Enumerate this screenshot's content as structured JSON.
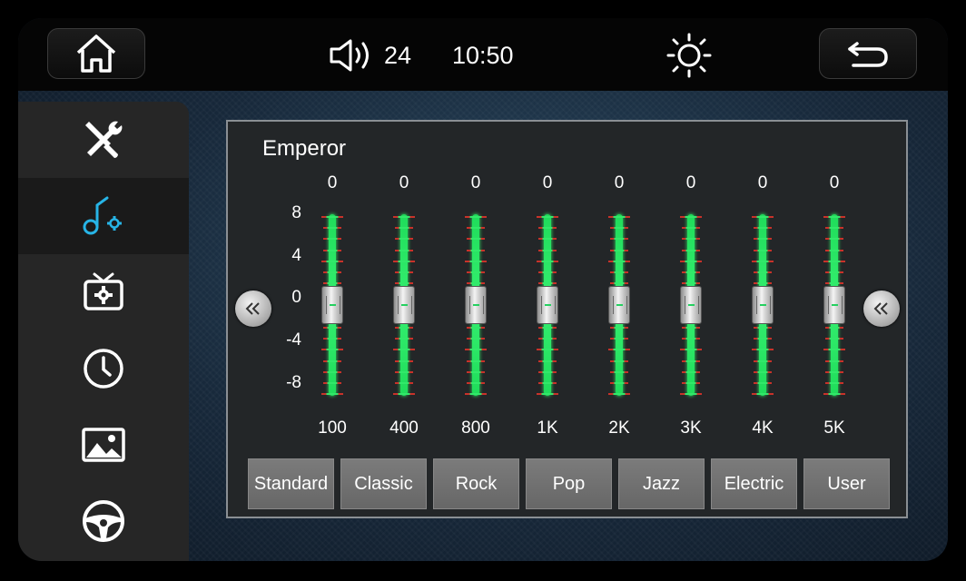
{
  "status": {
    "volume": "24",
    "time": "10:50"
  },
  "icons": {
    "home": "home-icon",
    "volume": "volume-icon",
    "brightness": "brightness-icon",
    "back": "back-icon",
    "sidebar": [
      "tools-icon",
      "music-settings-icon",
      "tv-settings-icon",
      "clock-icon",
      "gallery-icon",
      "steering-wheel-icon"
    ]
  },
  "colors": {
    "accent": "#27b4e6",
    "eq_green": "#32e86a",
    "tick_red": "#c8322a"
  },
  "equalizer": {
    "preset_name": "Emperor",
    "scale": [
      "8",
      "4",
      "0",
      "-4",
      "-8"
    ],
    "bands": [
      {
        "freq": "100",
        "value": "0",
        "level": 0
      },
      {
        "freq": "400",
        "value": "0",
        "level": 0
      },
      {
        "freq": "800",
        "value": "0",
        "level": 0
      },
      {
        "freq": "1K",
        "value": "0",
        "level": 0
      },
      {
        "freq": "2K",
        "value": "0",
        "level": 0
      },
      {
        "freq": "3K",
        "value": "0",
        "level": 0
      },
      {
        "freq": "4K",
        "value": "0",
        "level": 0
      },
      {
        "freq": "5K",
        "value": "0",
        "level": 0
      }
    ],
    "level_range": [
      -8,
      8
    ]
  },
  "presets": [
    "Standard",
    "Classic",
    "Rock",
    "Pop",
    "Jazz",
    "Electric",
    "User"
  ]
}
